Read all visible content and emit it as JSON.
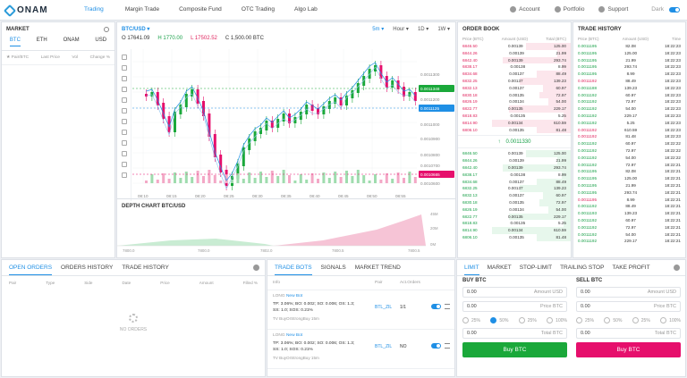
{
  "header": {
    "logo": "ONAM",
    "nav": [
      "Trading",
      "Margin Trade",
      "Composite Fund",
      "OTC Trading",
      "Algo Lab"
    ],
    "account": "Account",
    "portfolio": "Portfolio",
    "support": "Support",
    "theme": "Dark"
  },
  "market": {
    "title": "MARKET",
    "tabs": [
      "BTC",
      "ETH",
      "ONAM",
      "USD"
    ],
    "cols": [
      "Pair/BTC",
      "Last Price",
      "Vol",
      "Change %"
    ]
  },
  "chart": {
    "pair": "BTC/USD",
    "timeframes": [
      "5m",
      "Hour",
      "1D",
      "1W"
    ],
    "open": "O 17641.09",
    "high": "H 1770.00",
    "low": "L 17502.52",
    "close": "C 1,500.00 BTC",
    "depth_title": "DEPTH CHART BTC/USD",
    "price_labels": [
      "0.0011300",
      "0.0011348",
      "0.0011200",
      "0.0011125",
      "0.0011000",
      "0.0010900",
      "0.0010800",
      "0.0010700",
      "0.0010665",
      "0.0010600"
    ],
    "time_labels": [
      "08:10",
      "08:15",
      "08:20",
      "08:25",
      "08:30",
      "08:35",
      "08:40",
      "08:45",
      "08:50",
      "08:55"
    ],
    "depth_x": [
      "7800.0",
      "7800.0",
      "7802.0",
      "7800.5",
      "7800.5"
    ],
    "depth_y": [
      "45M",
      "20M",
      "0M"
    ]
  },
  "orderbook": {
    "title": "ORDER BOOK",
    "cols": [
      "Price (BTC)",
      "Amount (USD)",
      "Total (BTC)"
    ],
    "sells": [
      [
        "6846.50",
        "0.00139",
        "125.00"
      ],
      [
        "6844.26",
        "0.00139",
        "21.99"
      ],
      [
        "6842.40",
        "0.00139",
        "293.74"
      ],
      [
        "6838.17",
        "0.00138",
        "8.99"
      ],
      [
        "6834.68",
        "0.00137",
        "88.49"
      ],
      [
        "6832.25",
        "0.00137",
        "139.23"
      ],
      [
        "6832.13",
        "0.00137",
        "60.97"
      ],
      [
        "6830.18",
        "0.00135",
        "72.97"
      ],
      [
        "6826.19",
        "0.00134",
        "54.00"
      ],
      [
        "6822.77",
        "0.00135",
        "229.17"
      ],
      [
        "6818.83",
        "0.00135",
        "5.25"
      ],
      [
        "6814.90",
        "0.00134",
        "610.59"
      ],
      [
        "6806.10",
        "0.00135",
        "81.48"
      ]
    ],
    "last": "0.0011330",
    "buys": [
      [
        "6846.50",
        "0.00139",
        "125.00"
      ],
      [
        "6844.26",
        "0.00139",
        "21.99"
      ],
      [
        "6842.40",
        "0.00139",
        "293.74"
      ],
      [
        "6838.17",
        "0.00138",
        "8.99"
      ],
      [
        "6834.68",
        "0.00137",
        "88.49"
      ],
      [
        "6832.25",
        "0.00137",
        "139.23"
      ],
      [
        "6832.13",
        "0.00137",
        "60.97"
      ],
      [
        "6830.18",
        "0.00135",
        "72.97"
      ],
      [
        "6826.19",
        "0.00134",
        "54.00"
      ],
      [
        "6822.77",
        "0.00135",
        "229.17"
      ],
      [
        "6818.83",
        "0.00135",
        "5.25"
      ],
      [
        "6814.90",
        "0.00134",
        "610.59"
      ],
      [
        "6806.10",
        "0.00135",
        "81.48"
      ]
    ]
  },
  "trade_history": {
    "title": "TRADE HISTORY",
    "cols": [
      "Price (BTC)",
      "Amount (USD)",
      "Time"
    ],
    "rows": [
      [
        "0.0011195",
        "82.08",
        "18:22:23"
      ],
      [
        "0.0011195",
        "125.00",
        "18:22:23"
      ],
      [
        "0.0011195",
        "21.99",
        "18:22:23"
      ],
      [
        "0.0011195",
        "293.74",
        "18:22:23"
      ],
      [
        "0.0011195",
        "8.99",
        "18:22:23"
      ],
      [
        "0.0011192",
        "88.49",
        "18:22:23"
      ],
      [
        "0.0011188",
        "139.23",
        "18:22:23"
      ],
      [
        "0.0011192",
        "60.97",
        "18:22:23"
      ],
      [
        "0.0011192",
        "72.97",
        "18:22:23"
      ],
      [
        "0.0011192",
        "54.00",
        "18:22:23"
      ],
      [
        "0.0011192",
        "229.17",
        "18:22:23"
      ],
      [
        "0.0011192",
        "5.25",
        "18:22:23"
      ],
      [
        "0.0011192",
        "610.59",
        "18:22:23"
      ],
      [
        "0.0011192",
        "81.48",
        "18:22:23"
      ],
      [
        "0.0011192",
        "60.97",
        "18:22:22"
      ],
      [
        "0.0011192",
        "72.97",
        "18:22:22"
      ],
      [
        "0.0011192",
        "54.00",
        "18:22:22"
      ],
      [
        "0.0011192",
        "72.97",
        "18:22:21"
      ],
      [
        "0.0011195",
        "82.08",
        "18:22:21"
      ],
      [
        "0.0011195",
        "125.00",
        "18:22:21"
      ],
      [
        "0.0011195",
        "21.99",
        "18:22:21"
      ],
      [
        "0.0011195",
        "293.74",
        "18:22:21"
      ],
      [
        "0.0011195",
        "8.99",
        "18:22:21"
      ],
      [
        "0.0011192",
        "88.49",
        "18:22:21"
      ],
      [
        "0.0011193",
        "139.23",
        "18:22:21"
      ],
      [
        "0.0011192",
        "60.97",
        "18:22:21"
      ],
      [
        "0.0011192",
        "72.97",
        "18:22:21"
      ],
      [
        "0.0011192",
        "54.00",
        "18:22:21"
      ],
      [
        "0.0011192",
        "229.17",
        "18:22:21"
      ]
    ]
  },
  "orders": {
    "tabs": [
      "OPEN ORDERS",
      "ORDERS HISTORY",
      "TRADE HISTORY"
    ],
    "cols": [
      "Pair",
      "Type",
      "Side",
      "Date",
      "Price",
      "Amount",
      "Filled %"
    ],
    "empty": "NO ORDERS"
  },
  "bots": {
    "tabs": [
      "TRADE BOTS",
      "SIGNALS",
      "MARKET TREND"
    ],
    "cols": [
      "Info",
      "Pair",
      "Act.Orders"
    ],
    "items": [
      {
        "type": "LONG",
        "tag": "New Bot",
        "desc": "TP: 3.06%; BO: 0.002; SO: 0.006; OS: 1.3; SS: 1.0; SOS: 0.21%",
        "extra": "TV BuyOrStrongBuy 15m",
        "pair": "BTL_ZIL",
        "orders": "1/1"
      },
      {
        "type": "LONG",
        "tag": "New Bot",
        "desc": "TP: 3.06%; BO: 0.002; SO: 0.006; OS: 1.3; SS: 1.0; SOS: 0.21%",
        "extra": "TV BuyOrStrongBuy 15m",
        "pair": "BTL_ZIL",
        "orders": "NO"
      }
    ]
  },
  "trade": {
    "tabs": [
      "LIMIT",
      "MARKET",
      "STOP-LIMIT",
      "TRAILING STOP",
      "TAKE PROFIT"
    ],
    "buy": {
      "title": "BUY BTC",
      "amount_val": "0.00",
      "amount_lbl": "Amount USD",
      "price_val": "0.00",
      "price_lbl": "Price BTC",
      "pcts": [
        "25%",
        "50%",
        "25%",
        "100%"
      ],
      "total_val": "0.00",
      "total_lbl": "Total BTC",
      "button": "Buy BTC"
    },
    "sell": {
      "title": "SELL BTC",
      "amount_val": "0.00",
      "amount_lbl": "Amount USD",
      "price_val": "0.00",
      "price_lbl": "Price BTC",
      "pcts": [
        "25%",
        "50%",
        "25%",
        "100%"
      ],
      "total_val": "0.00",
      "total_lbl": "Total BTC",
      "button": "Buy BTC"
    }
  },
  "colors": {
    "accent": "#1f8fe5",
    "up": "#1aa14a",
    "down": "#e0245e",
    "buy_button": "#1aa83a",
    "sell_button": "#e60f6c"
  }
}
